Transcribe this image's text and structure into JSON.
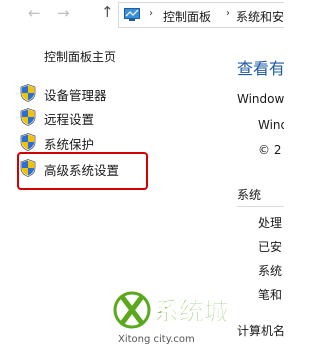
{
  "address_bar": {
    "segments": [
      "控制面板",
      "系统和安"
    ]
  },
  "left_pane": {
    "title": "控制面板主页",
    "links": [
      "设备管理器",
      "远程设置",
      "系统保护",
      "高级系统设置"
    ]
  },
  "right_pane": {
    "heading": "查看有",
    "edition_label": "Window",
    "edition_name": "Wind",
    "copyright": "© 2",
    "system_section": "系统",
    "system_rows": [
      "处理",
      "已安",
      "系统",
      "笔和",
      "计算机名"
    ]
  },
  "watermark": {
    "brand": "系统城",
    "url": "Xitong city.com"
  },
  "colors": {
    "highlight_border": "#d40000",
    "heading_blue": "#1e5aa8",
    "watermark_green": "#5aa81e"
  }
}
